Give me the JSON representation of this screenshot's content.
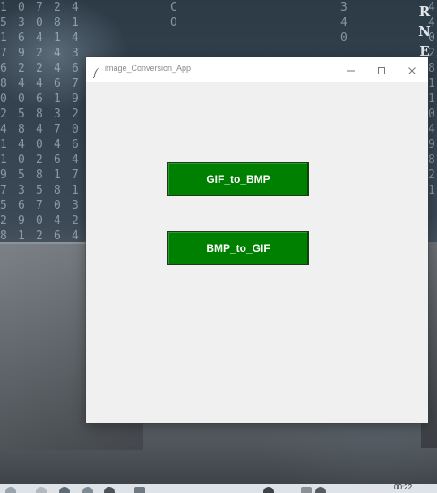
{
  "window": {
    "title": "image_Conversion_App",
    "minimize_glyph": "–",
    "maximize_glyph": "▢",
    "close_glyph": "✕"
  },
  "buttons": {
    "gif_to_bmp": "GIF_to_BMP",
    "bmp_to_gif": "BMP_to_GIF"
  },
  "taskbar": {
    "clock": "00:22"
  },
  "desktop": {
    "corner_letters": [
      "R",
      "N",
      "E"
    ]
  },
  "colors": {
    "button_green": "#008000",
    "window_bg": "#f0f0f0"
  },
  "icons": {
    "app": "feather-icon",
    "minimize": "minimize-icon",
    "maximize": "maximize-icon",
    "close": "close-icon"
  }
}
